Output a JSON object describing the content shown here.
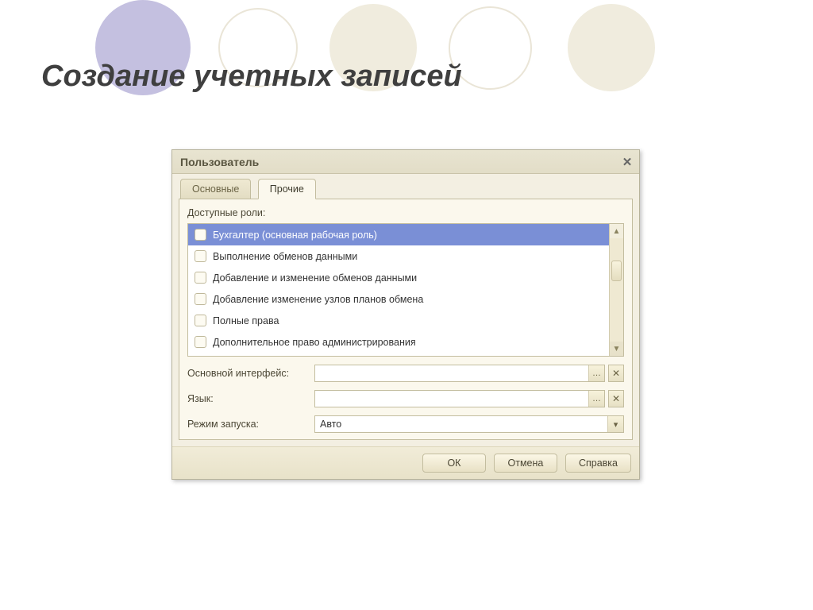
{
  "slide": {
    "title": "Создание учетных записей"
  },
  "dialog": {
    "title": "Пользователь",
    "tabs": [
      {
        "label": "Основные"
      },
      {
        "label": "Прочие"
      }
    ],
    "active_tab": 1,
    "roles_label": "Доступные роли:",
    "roles": [
      {
        "label": "Бухгалтер (основная рабочая роль)",
        "selected": true
      },
      {
        "label": "Выполнение обменов данными",
        "selected": false
      },
      {
        "label": "Добавление и изменение обменов данными",
        "selected": false
      },
      {
        "label": "Добавление изменение узлов планов обмена",
        "selected": false
      },
      {
        "label": "Полные права",
        "selected": false
      },
      {
        "label": "Дополнительное право администрирования",
        "selected": false
      }
    ],
    "fields": {
      "interface": {
        "label": "Основной интерфейс:",
        "value": ""
      },
      "language": {
        "label": "Язык:",
        "value": ""
      },
      "launch_mode": {
        "label": "Режим запуска:",
        "value": "Авто"
      }
    },
    "buttons": {
      "ok": "ОК",
      "cancel": "Отмена",
      "help": "Справка"
    }
  }
}
